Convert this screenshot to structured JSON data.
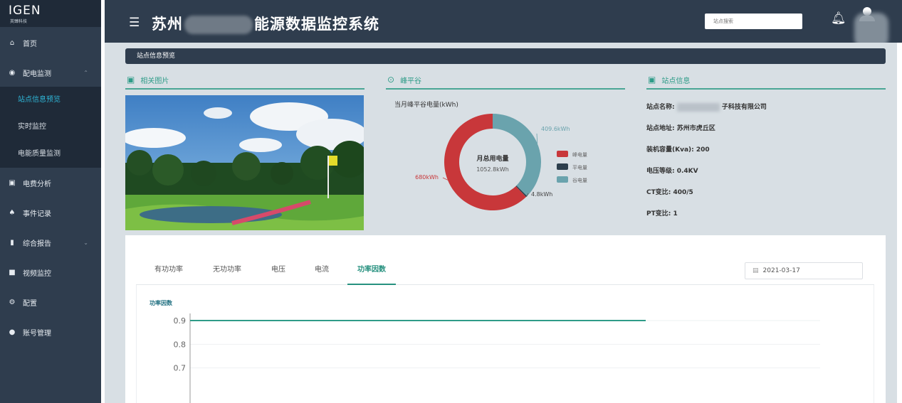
{
  "logo": {
    "text": "IGEN",
    "subtext": "英臻科技"
  },
  "sidebar": {
    "items": [
      {
        "icon": "home-icon",
        "label": "首页"
      },
      {
        "icon": "eye-icon",
        "label": "配电监测"
      },
      {
        "icon": "bill-icon",
        "label": "电费分析"
      },
      {
        "icon": "bell-icon",
        "label": "事件记录"
      },
      {
        "icon": "bar-chart-icon",
        "label": "综合报告"
      },
      {
        "icon": "camera-icon",
        "label": "视频监控"
      },
      {
        "icon": "gear-icon",
        "label": "配置"
      },
      {
        "icon": "user-icon",
        "label": "账号管理"
      }
    ],
    "subitems": [
      {
        "label": "站点信息预览",
        "active": true
      },
      {
        "label": "实时监控",
        "active": false
      },
      {
        "label": "电能质量监测",
        "active": false
      }
    ]
  },
  "header": {
    "title_left": "苏州",
    "title_right": "能源数据监控系统",
    "search_placeholder": "站点搜索"
  },
  "overview": {
    "label": "站点信息预览"
  },
  "sections": {
    "photo": "相关图片",
    "peak_valley": "峰平谷",
    "site_info": "站点信息"
  },
  "donut": {
    "title": "当月峰平谷电量(kWh)",
    "center_title": "月总用电量",
    "center_value": "1052.8kWh",
    "segments": [
      {
        "label": "峰电量",
        "value": 680,
        "text": "680kWh",
        "color": "#c8373a"
      },
      {
        "label": "平电量",
        "value": 4.8,
        "text": "4.8kWh",
        "color": "#2c3e4c"
      },
      {
        "label": "谷电量",
        "value": 409.6,
        "text": "409.6kWh",
        "color": "#6aa3ad"
      }
    ]
  },
  "site_info": {
    "name_label": "站点名称:",
    "name_value": "子科技有限公司",
    "address": "站点地址: 苏州市虎丘区",
    "capacity": "装机容量(Kva): 200",
    "voltage": "电压等级: 0.4KV",
    "ct": "CT变比: 400/5",
    "pt": "PT变比: 1"
  },
  "tabs": [
    {
      "label": "有功功率",
      "active": false
    },
    {
      "label": "无功功率",
      "active": false
    },
    {
      "label": "电压",
      "active": false
    },
    {
      "label": "电流",
      "active": false
    },
    {
      "label": "功率因数",
      "active": true
    }
  ],
  "date_picker": {
    "value": "2021-03-17"
  },
  "chart_data": {
    "type": "line",
    "title": "功率因数",
    "yticks": [
      "0.9",
      "0.8",
      "0.7"
    ],
    "ylim": [
      0.7,
      0.9
    ],
    "series": [
      {
        "values": [
          0.9,
          0.9
        ]
      }
    ],
    "line_color": "#2f9c88"
  }
}
